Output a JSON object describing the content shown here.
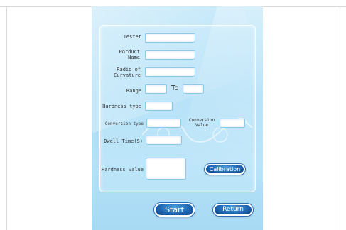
{
  "form": {
    "tester_label": "Tester",
    "product_name_label": "Porduct Name",
    "radius_label": "Radio of Curvature",
    "range_label": "Range",
    "range_to_label": "To",
    "hardness_type_label": "Hardness type",
    "conversion_type_label": "Conversion type",
    "conversion_value_label": "Conversion Value",
    "dwell_time_label": "Dwell Time(S)",
    "hardness_value_label": "Hardness value"
  },
  "buttons": {
    "calibration": "Calibration",
    "start": "Start",
    "return": "Return"
  },
  "colors": {
    "screen_bg": "#b4e1f7",
    "button_fill": "#1b63b0",
    "field_border": "#8ec9ea"
  }
}
